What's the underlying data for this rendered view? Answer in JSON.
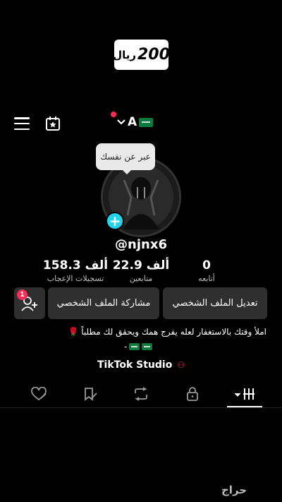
{
  "price_badge": {
    "amount": "200",
    "currency": "ريال"
  },
  "top_bar": {
    "account_initial": "A"
  },
  "tooltip": {
    "text": "عبر عن نفسك"
  },
  "profile": {
    "username": "@njnx6",
    "stats": [
      {
        "value": "0",
        "label": "أتابعه"
      },
      {
        "value": "22.9 ألف",
        "label": "متابعين"
      },
      {
        "value": "158.3 ألف",
        "label": "تسجيلات الإعجاب"
      }
    ]
  },
  "buttons": {
    "edit_profile": "تعديل الملف الشخصي",
    "share_profile": "مشاركة الملف الشخصي",
    "friend_requests_count": "1"
  },
  "bio": {
    "line1": "املأ وقتك بالاستغفار لعله يفرج همك ويحقق لك مطلباً 🌹",
    "line2": "-"
  },
  "studio_link": {
    "label": "TikTok Studio"
  },
  "tabs": [
    "videos",
    "reposts",
    "favorites",
    "liked",
    "private"
  ],
  "watermark": {
    "text": "حراج"
  },
  "colors": {
    "accent_red": "#fe2c55",
    "accent_cyan": "#20d5ec",
    "button_bg": "#2f2f2f"
  },
  "icons": [
    "hamburger-menu-icon",
    "calendar-star-icon",
    "chevron-down-icon",
    "plus-icon",
    "add-friend-icon",
    "studio-icon",
    "videos-grid-icon",
    "repost-icon",
    "bookmark-icon",
    "liked-heart-icon",
    "lock-icon"
  ]
}
